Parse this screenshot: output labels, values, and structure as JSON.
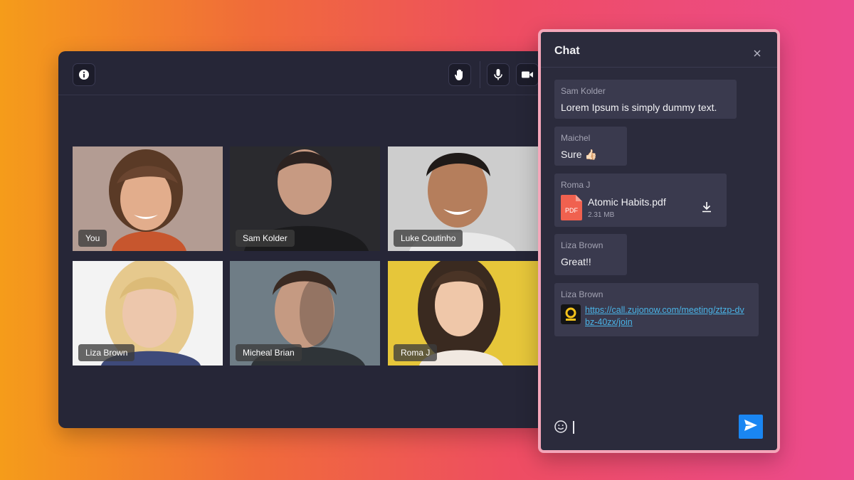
{
  "meeting": {
    "toolbar": {
      "info_icon": "info-icon",
      "raise_hand_icon": "hand-icon",
      "mic_icon": "microphone-icon",
      "camera_icon": "video-camera-icon"
    },
    "participants": [
      {
        "name": "You"
      },
      {
        "name": "Sam Kolder"
      },
      {
        "name": "Luke Coutinho"
      },
      {
        "name": "Liza Brown"
      },
      {
        "name": "Micheal Brian"
      },
      {
        "name": "Roma J"
      }
    ]
  },
  "chat": {
    "title": "Chat",
    "messages": [
      {
        "sender": "Sam Kolder",
        "text": "Lorem Ipsum is simply dummy text."
      },
      {
        "sender": "Maichel",
        "text": "Sure 👍🏻"
      },
      {
        "sender": "Roma J",
        "file_name": "Atomic Habits.pdf",
        "file_size": "2.31 MB",
        "file_type": "PDF"
      },
      {
        "sender": "Liza Brown",
        "text": "Great!!"
      },
      {
        "sender": "Liza Brown",
        "link": "https://call.zujonow.com/meeting/ztzp-dvbz-40zx/join"
      }
    ]
  },
  "colors": {
    "window_bg": "#262637",
    "chat_bg": "#2b2b3c",
    "chat_border": "#f4a6b9",
    "bubble_bg": "#3a3a4e",
    "link": "#4ab3e6",
    "send_button": "#1a86f2",
    "pdf_red": "#f0614f"
  }
}
